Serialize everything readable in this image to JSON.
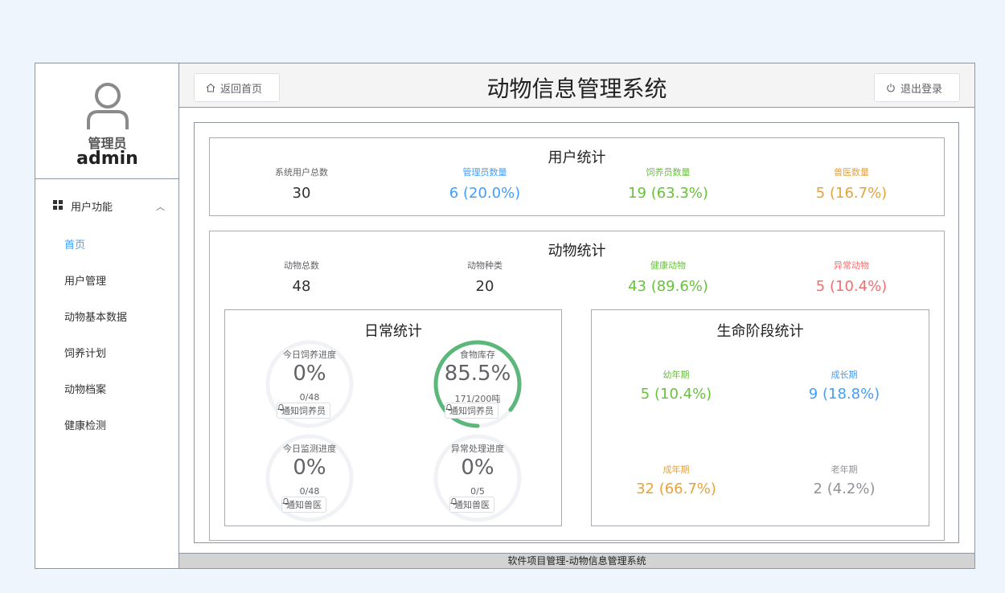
{
  "sidebar": {
    "role": "管理员",
    "username": "admin",
    "group_label": "用户功能",
    "items": [
      {
        "label": "首页"
      },
      {
        "label": "用户管理"
      },
      {
        "label": "动物基本数据"
      },
      {
        "label": "饲养计划"
      },
      {
        "label": "动物档案"
      },
      {
        "label": "健康检测"
      }
    ]
  },
  "header": {
    "home_label": "返回首页",
    "title": "动物信息管理系统",
    "logout_label": "退出登录"
  },
  "user_stats": {
    "title": "用户统计",
    "items": [
      {
        "label": "系统用户总数",
        "value": "30"
      },
      {
        "label": "管理员数量",
        "value": "6 (20.0%)"
      },
      {
        "label": "饲养员数量",
        "value": "19 (63.3%)"
      },
      {
        "label": "兽医数量",
        "value": "5 (16.7%)"
      }
    ]
  },
  "animal_stats": {
    "title": "动物统计",
    "items": [
      {
        "label": "动物总数",
        "value": "48"
      },
      {
        "label": "动物种类",
        "value": "20"
      },
      {
        "label": "健康动物",
        "value": "43 (89.6%)"
      },
      {
        "label": "异常动物",
        "value": "5 (10.4%)"
      }
    ]
  },
  "daily_stats": {
    "title": "日常统计",
    "gauges": [
      {
        "label": "今日饲养进度",
        "percent_text": "0%",
        "percent": 0,
        "sub": "0/48",
        "button": "通知饲养员"
      },
      {
        "label": "食物库存",
        "percent_text": "85.5%",
        "percent": 85.5,
        "sub": "171/200吨",
        "button": "通知饲养员"
      },
      {
        "label": "今日监测进度",
        "percent_text": "0%",
        "percent": 0,
        "sub": "0/48",
        "button": "通知兽医"
      },
      {
        "label": "异常处理进度",
        "percent_text": "0%",
        "percent": 0,
        "sub": "0/5",
        "button": "通知兽医"
      }
    ]
  },
  "life_stats": {
    "title": "生命阶段统计",
    "items": [
      {
        "label": "幼年期",
        "value": "5 (10.4%)"
      },
      {
        "label": "成长期",
        "value": "9 (18.8%)"
      },
      {
        "label": "成年期",
        "value": "32 (66.7%)"
      },
      {
        "label": "老年期",
        "value": "2 (4.2%)"
      }
    ]
  },
  "footer": {
    "text": "软件项目管理-动物信息管理系统"
  },
  "colors": {
    "accent": "#409eff",
    "success": "#67c23a",
    "warning": "#e6a23c",
    "danger": "#f56c6c",
    "gauge_fill": "#5cb87a",
    "gauge_track": "#f0f2f5"
  },
  "icons": {
    "avatar": "user-icon",
    "menu_group": "grid-icon",
    "home": "home-icon",
    "logout": "power-icon",
    "notify": "bell-icon"
  }
}
